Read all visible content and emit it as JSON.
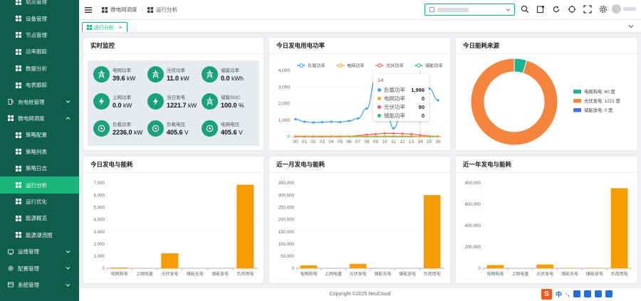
{
  "sidebar": {
    "items": [
      {
        "label": "站点管理",
        "icon": "grid-icon",
        "kind": "sub"
      },
      {
        "label": "设备管理",
        "icon": "device-icon",
        "kind": "sub"
      },
      {
        "label": "节点管理",
        "icon": "node-icon",
        "kind": "sub"
      },
      {
        "label": "功率跟踪",
        "icon": "power-icon",
        "kind": "sub"
      },
      {
        "label": "数据分析",
        "icon": "data-icon",
        "kind": "sub"
      },
      {
        "label": "电表跟踪",
        "icon": "meter-icon",
        "kind": "sub"
      },
      {
        "label": "充电桩管理",
        "icon": "charger-icon",
        "kind": "group"
      },
      {
        "label": "微电网调度",
        "icon": "grid-icon",
        "kind": "group"
      },
      {
        "label": "策略配置",
        "icon": "strategy-icon",
        "kind": "sub"
      },
      {
        "label": "策略列表",
        "icon": "list-icon",
        "kind": "sub"
      },
      {
        "label": "策略日志",
        "icon": "log-icon",
        "kind": "sub"
      },
      {
        "label": "运行分析",
        "icon": "grid-icon",
        "kind": "sub",
        "active": true
      },
      {
        "label": "运行优化",
        "icon": "optimize-icon",
        "kind": "sub"
      },
      {
        "label": "能源概览",
        "icon": "overview-icon",
        "kind": "sub"
      },
      {
        "label": "能源潮流图",
        "icon": "flow-icon",
        "kind": "sub"
      },
      {
        "label": "运维管理",
        "icon": "ops-icon",
        "kind": "group"
      },
      {
        "label": "配置管理",
        "icon": "gear-icon",
        "kind": "group"
      },
      {
        "label": "系统管理",
        "icon": "system-icon",
        "kind": "group"
      }
    ]
  },
  "header": {
    "breadcrumb": [
      "微电网调度",
      "运行分析"
    ]
  },
  "tabs": [
    {
      "label": "运行分析"
    }
  ],
  "colors": {
    "accent": "#18b67a",
    "sidebar": "#0f5e4b",
    "bar": "#f59c00",
    "pv": "#f5843c",
    "grid": "#1ab394",
    "storage": "#4a6cf7"
  },
  "monitor": {
    "title": "实时监控",
    "items": [
      {
        "label": "电网功率",
        "value": "39.6",
        "unit": "kW",
        "icon": "tower-icon"
      },
      {
        "label": "光伏功率",
        "value": "11.0",
        "unit": "kW",
        "icon": "tower-icon"
      },
      {
        "label": "储能功率",
        "value": "0.0",
        "unit": "kWh",
        "icon": "tower-icon"
      },
      {
        "label": "上网功率",
        "value": "0.0",
        "unit": "kW",
        "icon": "bolt-icon"
      },
      {
        "label": "当日发电",
        "value": "1221.7",
        "unit": "kW",
        "icon": "bolt-icon"
      },
      {
        "label": "储能SOC",
        "value": "100.0",
        "unit": "%",
        "icon": "tower-icon"
      },
      {
        "label": "负载功率",
        "value": "2236.0",
        "unit": "kW",
        "icon": "load-icon"
      },
      {
        "label": "负载电压",
        "value": "405.6",
        "unit": "V",
        "icon": "load-icon"
      },
      {
        "label": "电网电压",
        "value": "405.6",
        "unit": "V",
        "icon": "load-icon"
      }
    ]
  },
  "power_card": {
    "title": "今日发电用电功率"
  },
  "source_card": {
    "title": "今日能耗来源"
  },
  "day_card": {
    "title": "今日发电与能耗"
  },
  "month_card": {
    "title": "近一月发电与能耗"
  },
  "year_card": {
    "title": "近一年发电与能耗"
  },
  "tooltip": {
    "header": "14",
    "rows": [
      {
        "name": "负载功率",
        "value": "1,996"
      },
      {
        "name": "电网功率",
        "value": "0"
      },
      {
        "name": "光伏功率",
        "value": "90"
      },
      {
        "name": "储能功率",
        "value": "0"
      }
    ]
  },
  "footer": {
    "text": "Copyright ©2025 NeuCloud"
  },
  "chart_data": [
    {
      "type": "line",
      "title": "今日发电用电功率",
      "x": [
        "00",
        "01",
        "02",
        "03",
        "04",
        "05",
        "06",
        "07",
        "08",
        "09",
        "10",
        "11",
        "12",
        "13",
        "14",
        "15",
        "16"
      ],
      "ylim": [
        0,
        4000
      ],
      "yticks": [
        "0",
        "1,000",
        "2,000",
        "3,000",
        "4,000"
      ],
      "series": [
        {
          "name": "负载功率",
          "color": "#3ba0e8",
          "values": [
            1050,
            900,
            850,
            870,
            900,
            880,
            950,
            1100,
            1700,
            3500,
            2200,
            500,
            1600,
            2900,
            1996,
            2900,
            2200
          ]
        },
        {
          "name": "电网功率",
          "color": "#f5a623",
          "values": [
            30,
            30,
            30,
            30,
            30,
            30,
            30,
            30,
            30,
            30,
            30,
            30,
            30,
            30,
            0,
            30,
            30
          ]
        },
        {
          "name": "光伏功率",
          "color": "#ee5a5a",
          "values": [
            0,
            0,
            0,
            0,
            0,
            0,
            20,
            60,
            120,
            160,
            200,
            200,
            180,
            150,
            90,
            40,
            10
          ]
        },
        {
          "name": "储能功率",
          "color": "#2bbf6f",
          "values": [
            0,
            0,
            0,
            0,
            0,
            0,
            0,
            0,
            0,
            0,
            0,
            0,
            0,
            0,
            0,
            0,
            0
          ]
        }
      ],
      "legend": "top",
      "grid": true
    },
    {
      "type": "pie",
      "title": "今日能耗来源",
      "slices": [
        {
          "name": "电网购电",
          "label": "电网购电: 60 度",
          "value": 60,
          "color": "#1ab394"
        },
        {
          "name": "光伏发电",
          "label": "光伏发电: 1221 度",
          "value": 1221,
          "color": "#f5843c"
        },
        {
          "name": "储能放电",
          "label": "储能放电: 0 度",
          "value": 0,
          "color": "#4a6cf7"
        }
      ],
      "legend": "right"
    },
    {
      "type": "bar",
      "title": "今日发电与能耗",
      "categories": [
        "电网购电",
        "上网电量",
        "光伏发电",
        "储能充电",
        "储能放电",
        "负荷用电"
      ],
      "values": [
        60,
        0,
        1221,
        0,
        0,
        6850
      ],
      "ylim": [
        0,
        7000
      ],
      "yticks": [
        "0",
        "1,000",
        "2,000",
        "3,000",
        "4,000",
        "5,000",
        "6,000",
        "7,000"
      ]
    },
    {
      "type": "bar",
      "title": "近一月发电与能耗",
      "categories": [
        "电网购电",
        "上网电量",
        "光伏发电",
        "储能充电",
        "储能放电",
        "负荷用电"
      ],
      "values": [
        12000,
        0,
        18000,
        0,
        0,
        300000
      ],
      "ylim": [
        0,
        350000
      ],
      "yticks": [
        "0",
        "50,000",
        "100,000",
        "150,000",
        "200,000",
        "250,000",
        "300,000",
        "350,000"
      ]
    },
    {
      "type": "bar",
      "title": "近一年发电与能耗",
      "categories": [
        "电网购电",
        "上网电量",
        "光伏发电",
        "储能充电",
        "储能放电",
        "负荷用电"
      ],
      "values": [
        30000,
        0,
        35000,
        3000,
        3000,
        750000
      ],
      "ylim": [
        0,
        800000
      ],
      "yticks": [
        "0",
        "200,000",
        "400,000",
        "600,000",
        "800,000"
      ]
    }
  ]
}
